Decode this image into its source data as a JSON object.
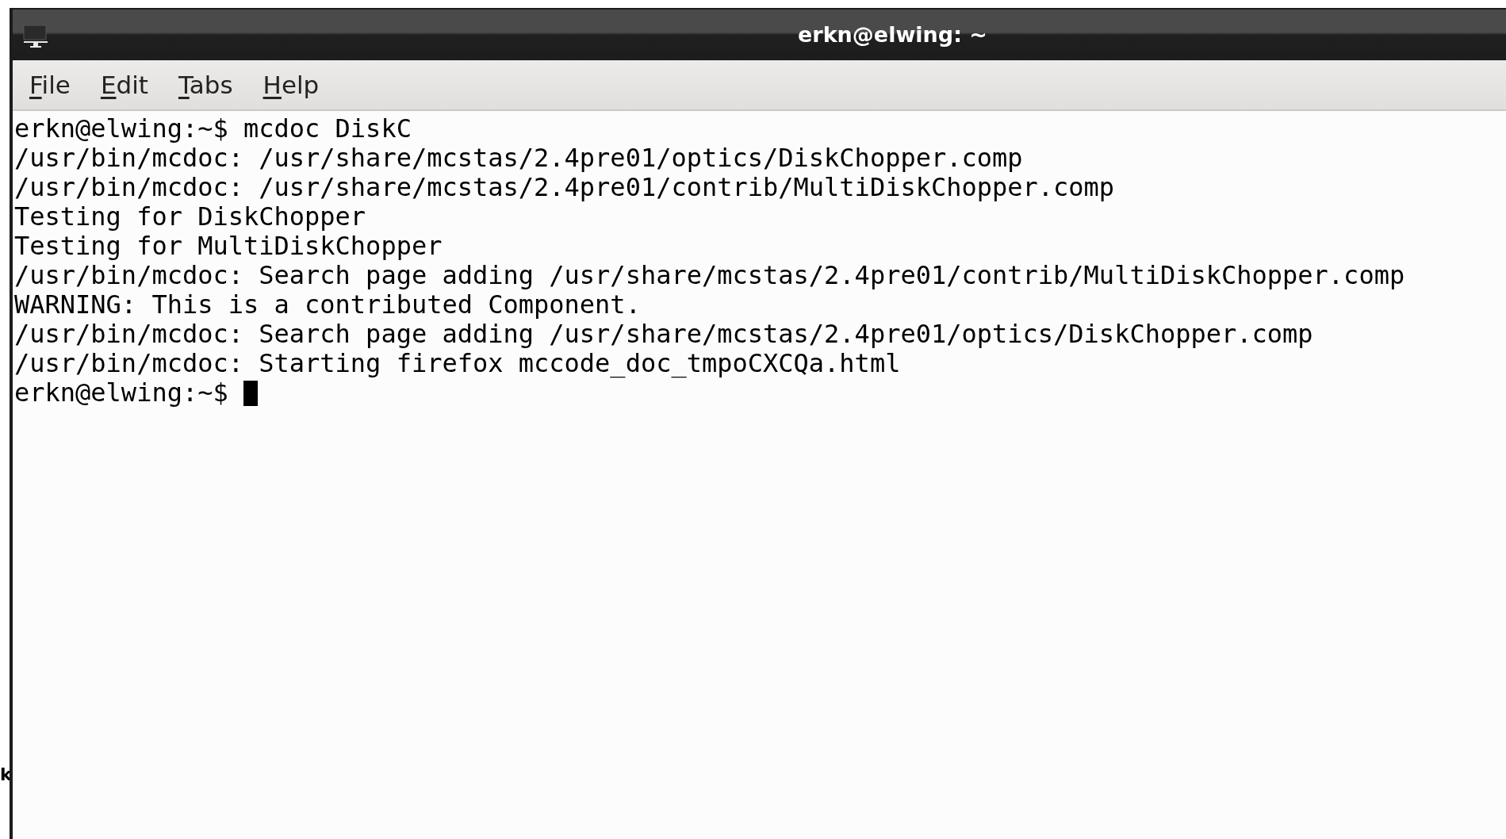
{
  "background_text": "k",
  "window": {
    "title": "erkn@elwing: ~"
  },
  "menu": [
    {
      "label": "File"
    },
    {
      "label": "Edit"
    },
    {
      "label": "Tabs"
    },
    {
      "label": "Help"
    }
  ],
  "terminal": {
    "lines": [
      "erkn@elwing:~$ mcdoc DiskC",
      "/usr/bin/mcdoc: /usr/share/mcstas/2.4pre01/optics/DiskChopper.comp",
      "/usr/bin/mcdoc: /usr/share/mcstas/2.4pre01/contrib/MultiDiskChopper.comp",
      "Testing for DiskChopper",
      "Testing for MultiDiskChopper",
      "/usr/bin/mcdoc: Search page adding /usr/share/mcstas/2.4pre01/contrib/MultiDiskChopper.comp",
      "WARNING: This is a contributed Component.",
      "/usr/bin/mcdoc: Search page adding /usr/share/mcstas/2.4pre01/optics/DiskChopper.comp",
      "/usr/bin/mcdoc: Starting firefox mccode_doc_tmpoCXCQa.html"
    ],
    "prompt": "erkn@elwing:~$ "
  }
}
